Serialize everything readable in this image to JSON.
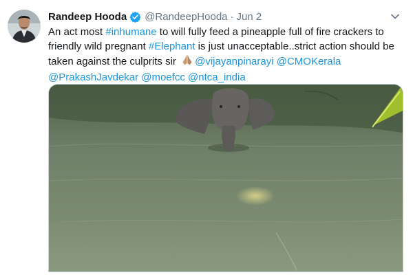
{
  "tweet": {
    "author_name": "Randeep Hooda",
    "author_handle": "@RandeepHooda",
    "separator": "·",
    "date": "Jun 2",
    "lines": [
      [
        {
          "t": "An act most ",
          "link": false
        },
        {
          "t": "#inhumane",
          "link": true
        },
        {
          "t": " to will fully feed a pineapple full of fire crackers to",
          "link": false
        }
      ],
      [
        {
          "t": "friendly wild pregnant ",
          "link": false
        },
        {
          "t": "#Elephant",
          "link": true
        },
        {
          "t": " is just unacceptable..strict action should be",
          "link": false
        }
      ],
      [
        {
          "t": "taken against the culprits  sir ",
          "link": false
        },
        {
          "emoji": "folded-hands-emoji"
        },
        {
          "t": "@vijayanpinarayi",
          "link": true
        },
        {
          "t": " ",
          "link": false
        },
        {
          "t": "@CMOKerala",
          "link": true
        }
      ],
      [
        {
          "t": "@PrakashJavdekar",
          "link": true
        },
        {
          "t": " ",
          "link": false
        },
        {
          "t": "@moefcc",
          "link": true
        },
        {
          "t": " ",
          "link": false
        },
        {
          "t": "@ntca_india",
          "link": true
        }
      ]
    ]
  },
  "colors": {
    "link": "#1b95e0",
    "verified_badge": "#1da1f2",
    "secondary_text": "#657786",
    "border": "#ccd6dd"
  },
  "icons": {
    "verified": "verified-badge-icon",
    "menu": "chevron-down-icon",
    "emoji": "folded-hands-emoji"
  },
  "media": {
    "kind": "photo",
    "subject": "elephant standing in river water"
  }
}
